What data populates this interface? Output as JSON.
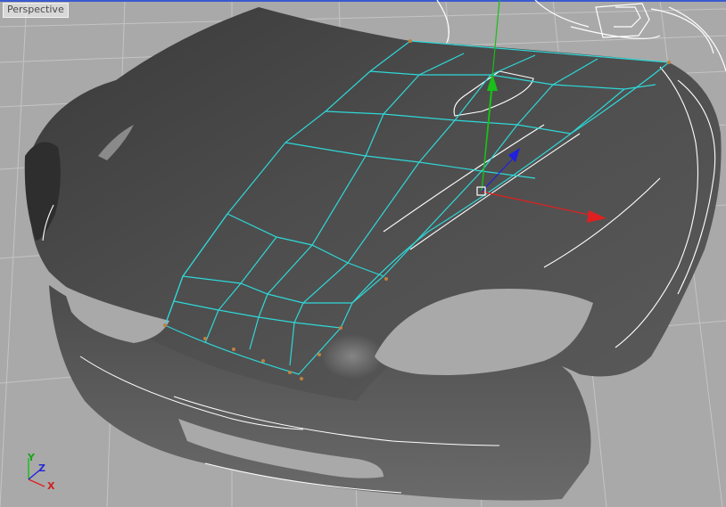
{
  "viewport": {
    "label": "Perspective",
    "colors": {
      "background": "#a9a9a9",
      "grid": "#c8c8c8",
      "mesh_body": "#4a4a4a",
      "selection_wire": "#2fd8d8",
      "vertex": "#c08040",
      "axis_x": "#e02020",
      "axis_y": "#18c018",
      "axis_z": "#2020e0"
    }
  },
  "axis_triad": {
    "x_label": "X",
    "y_label": "Y",
    "z_label": "Z"
  },
  "gizmo": {
    "icon": "move-gizmo-icon"
  }
}
